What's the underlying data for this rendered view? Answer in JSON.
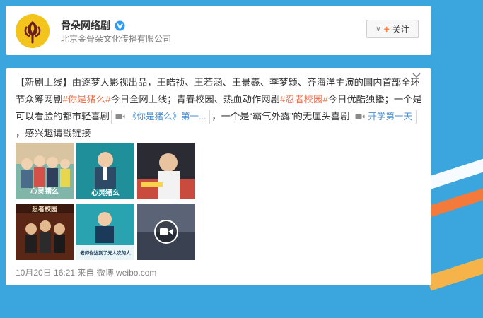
{
  "profile": {
    "name": "骨朵网络剧",
    "company": "北京金骨朵文化传播有限公司",
    "follow_label": "关注"
  },
  "post": {
    "segments": [
      {
        "type": "plain",
        "text": "【新剧上线】由逐梦人影视出品，王皓祯、王若涵、王景羲、李梦颖、齐海洋主演的国内首部全环节众筹网剧"
      },
      {
        "type": "topic",
        "text": "#你是猪么#"
      },
      {
        "type": "plain",
        "text": "今日全网上线；青春校园、热血动作网剧"
      },
      {
        "type": "topic",
        "text": "#忍者校园#"
      },
      {
        "type": "plain",
        "text": "今日优酷独播；一个是可以看脸的都市轻喜剧"
      },
      {
        "type": "link",
        "text": "《你是猪么》第一..."
      },
      {
        "type": "plain",
        "text": "，一个是“霸气外露”的无厘头喜剧"
      },
      {
        "type": "link",
        "text": "开学第一天"
      },
      {
        "type": "plain",
        "text": "，感兴趣请戳链接"
      }
    ],
    "footer": "10月20日 16:21 来自 微博 weibo.com"
  },
  "thumbnails": [
    {
      "name": "poster-1",
      "overlay": "心灵猪么"
    },
    {
      "name": "poster-2",
      "overlay": "心灵猪么"
    },
    {
      "name": "still-3",
      "overlay": ""
    },
    {
      "name": "poster-4",
      "overlay": "忍者校园"
    },
    {
      "name": "poster-5",
      "overlay": "老师你达到了元人次的人"
    },
    {
      "name": "video-6",
      "overlay": ""
    }
  ],
  "colors": {
    "page_bg": "#3aa6dd",
    "topic": "#eb7350",
    "link": "#4b8fd0",
    "follow_plus": "#ff8140",
    "verify": "#2d9bf0"
  },
  "icons": {
    "verify": "verified-v-icon",
    "follow": "plus-icon",
    "menu": "chevron-down-icon",
    "video": "video-camera-icon",
    "play": "play-icon"
  }
}
